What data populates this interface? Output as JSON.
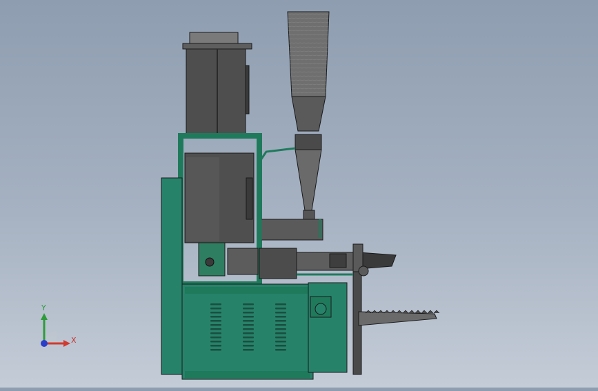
{
  "viewport": {
    "background_top": "#8e9db0",
    "background_bottom": "#c4ccd7",
    "model_colors": {
      "frame_green": "#1f7a5c",
      "panel_green": "#27826a",
      "dark_gray": "#4b4b4b",
      "mid_gray": "#6b6b6b",
      "light_gray": "#9a9a9a",
      "edge": "#1a1a1a"
    }
  },
  "triad": {
    "x_label": "X",
    "y_label": "Y",
    "x_color": "#d13a2e",
    "y_color": "#2e9b3a",
    "z_color": "#2b3ec9"
  }
}
